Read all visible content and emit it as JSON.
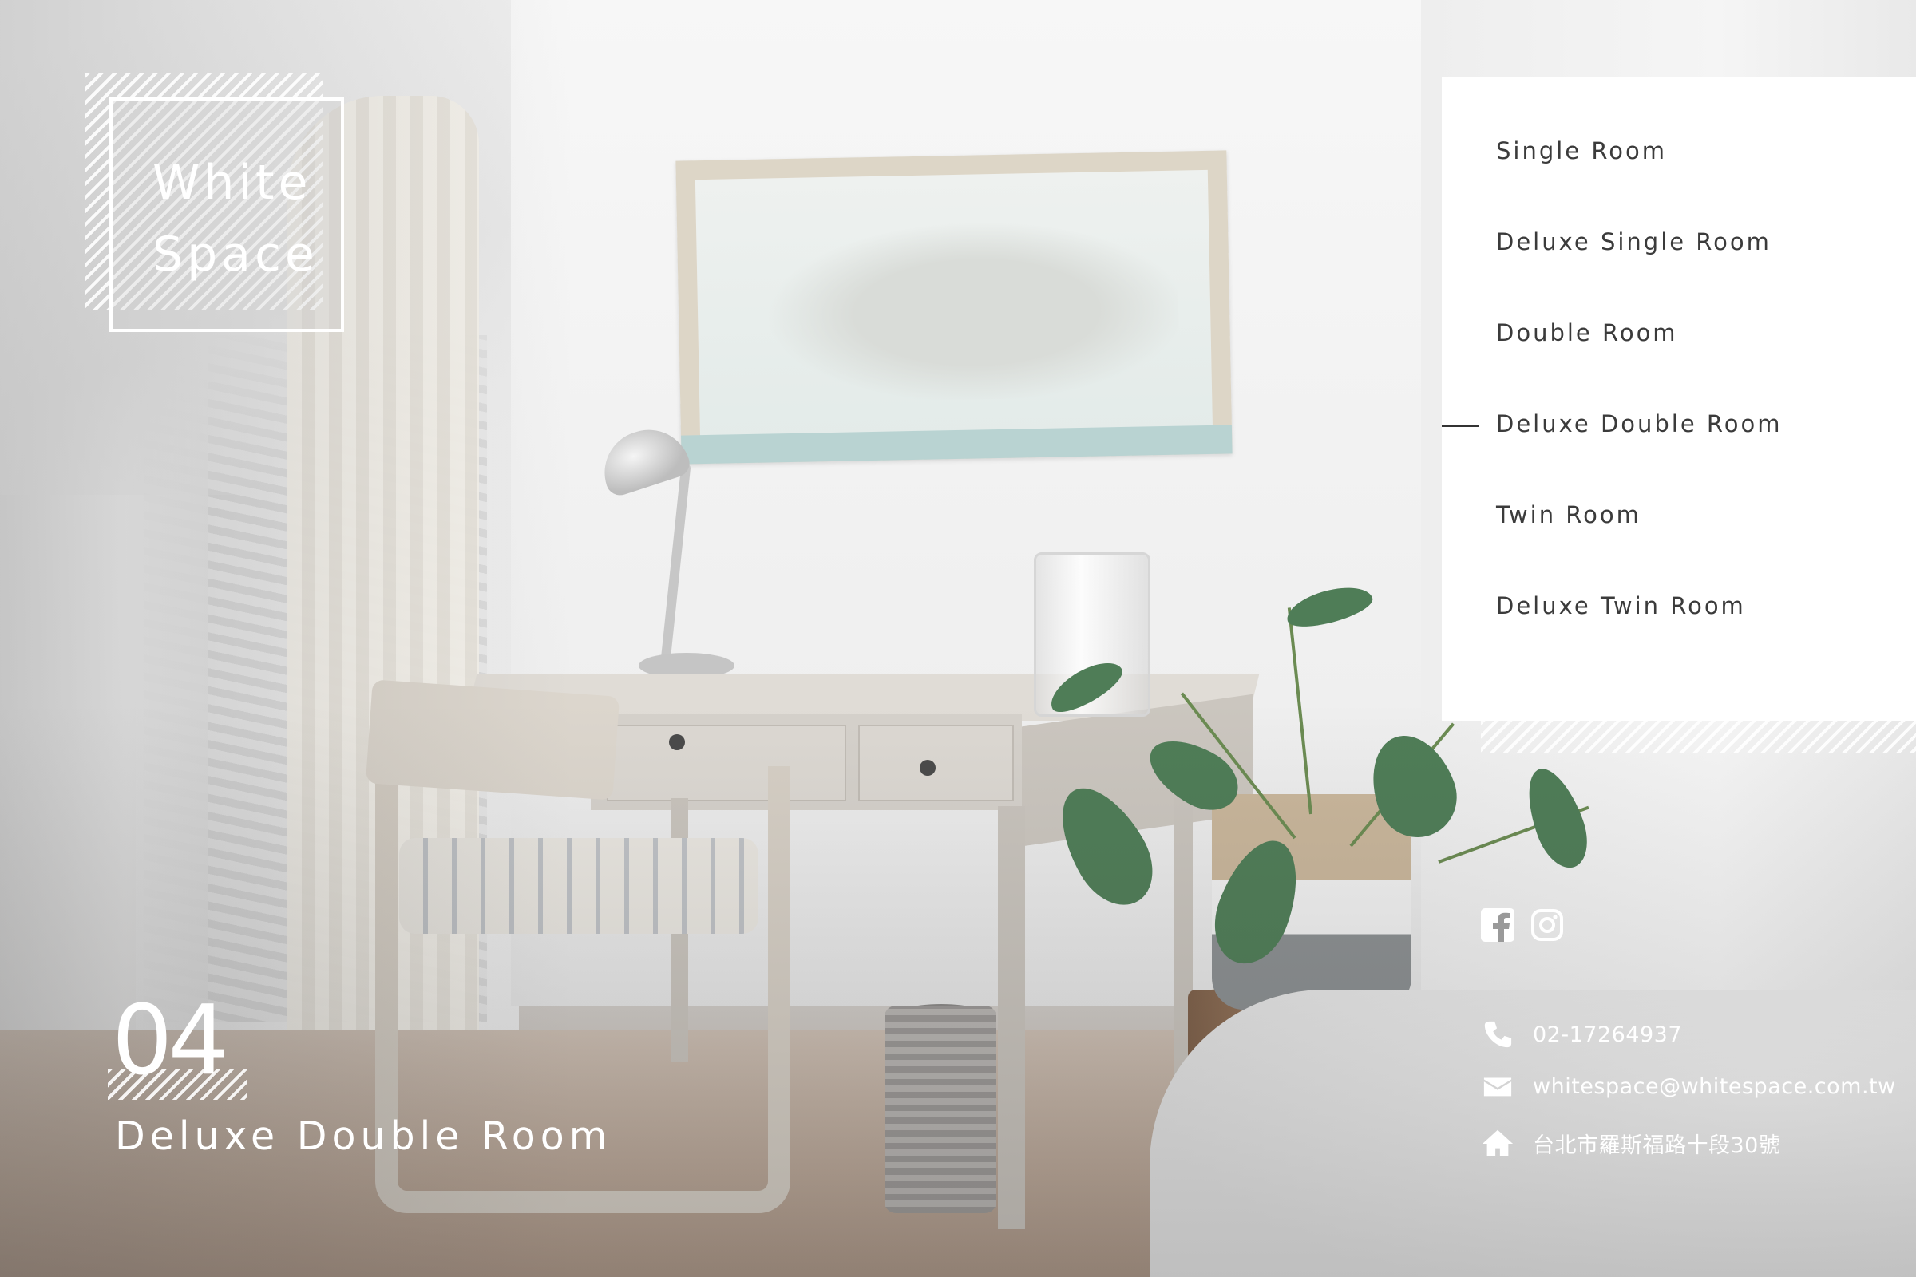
{
  "brand": {
    "line1": "White",
    "line2": "Space"
  },
  "menu": {
    "items": [
      {
        "label": "Single Room",
        "active": false
      },
      {
        "label": "Deluxe Single Room",
        "active": false
      },
      {
        "label": "Double Room",
        "active": false
      },
      {
        "label": "Deluxe Double Room",
        "active": true
      },
      {
        "label": "Twin Room",
        "active": false
      },
      {
        "label": "Deluxe Twin Room",
        "active": false
      }
    ]
  },
  "current_room": {
    "number": "04",
    "name": "Deluxe Double Room"
  },
  "social": {
    "icons": [
      "facebook-icon",
      "instagram-icon"
    ]
  },
  "contact": {
    "phone": "02-17264937",
    "email": "whitespace@whitespace.com.tw",
    "address": "台北市羅斯福路十段30號"
  },
  "colors": {
    "menu_background": "#ffffff",
    "menu_text": "#3b3b3b",
    "overlay_text": "#ffffff"
  }
}
